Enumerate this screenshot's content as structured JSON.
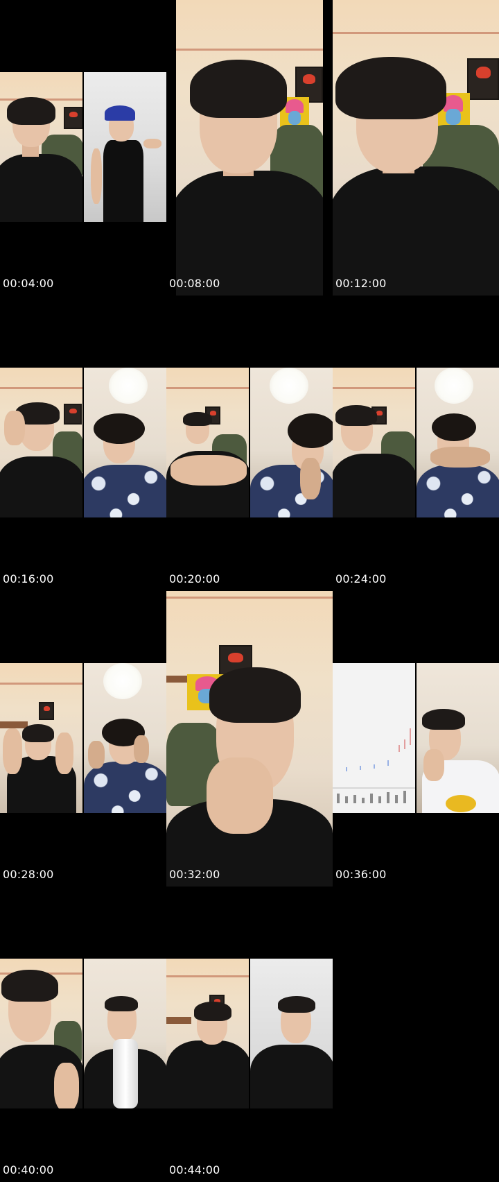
{
  "timestamps": [
    "00:04:00",
    "00:08:00",
    "00:12:00",
    "00:16:00",
    "00:20:00",
    "00:24:00",
    "00:28:00",
    "00:32:00",
    "00:36:00",
    "00:40:00",
    "00:44:00"
  ],
  "thumbnails": [
    {
      "label": "00:04:00",
      "layout": "split"
    },
    {
      "label": "00:08:00",
      "layout": "single"
    },
    {
      "label": "00:12:00",
      "layout": "single"
    },
    {
      "label": "00:16:00",
      "layout": "split"
    },
    {
      "label": "00:20:00",
      "layout": "split"
    },
    {
      "label": "00:24:00",
      "layout": "split"
    },
    {
      "label": "00:28:00",
      "layout": "split"
    },
    {
      "label": "00:32:00",
      "layout": "single"
    },
    {
      "label": "00:36:00",
      "layout": "split"
    },
    {
      "label": "00:40:00",
      "layout": "split"
    },
    {
      "label": "00:44:00",
      "layout": "split"
    }
  ],
  "colors": {
    "background": "#000000",
    "timestamp_text": "#ffffff",
    "wall": "#f0e0c8",
    "shirt": "#131313",
    "hawaiian_shirt": "#2d3a62"
  },
  "icons": [
    "person-silhouette",
    "ceiling-lamp",
    "poster",
    "stock-chart"
  ]
}
